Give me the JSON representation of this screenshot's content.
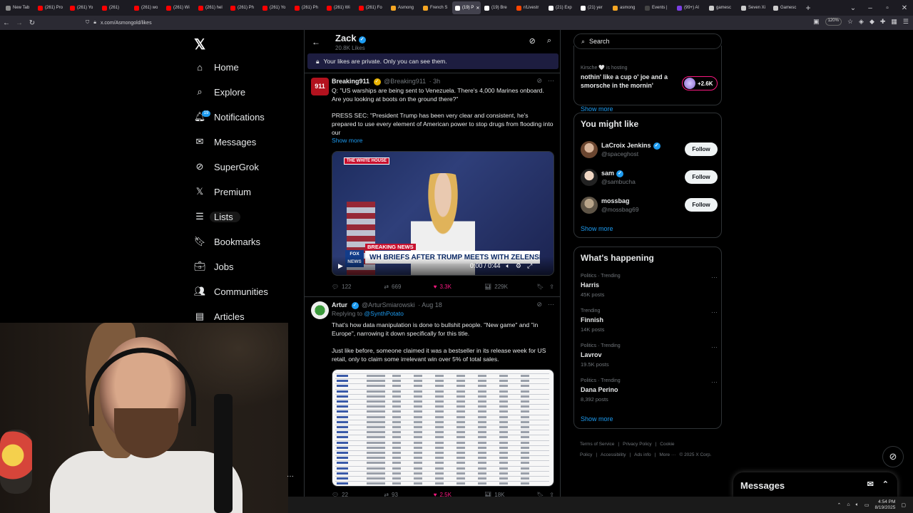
{
  "browser": {
    "tabs": [
      {
        "label": "New Tab",
        "color": "#8a8a8a"
      },
      {
        "label": "(261) Pro",
        "color": "#ff0000"
      },
      {
        "label": "(261) Yo",
        "color": "#ff0000"
      },
      {
        "label": "(261)",
        "color": "#ff0000"
      },
      {
        "label": "(261) wo",
        "color": "#ff0000"
      },
      {
        "label": "(261) Wi",
        "color": "#ff0000"
      },
      {
        "label": "(261) hel",
        "color": "#ff0000"
      },
      {
        "label": "(261) Ph",
        "color": "#ff0000"
      },
      {
        "label": "(261) Yo",
        "color": "#ff0000"
      },
      {
        "label": "(261) Ph",
        "color": "#ff0000"
      },
      {
        "label": "(261) Wi",
        "color": "#ff0000"
      },
      {
        "label": "(261) Fo",
        "color": "#ff0000"
      },
      {
        "label": "Asmong",
        "color": "#f5a623"
      },
      {
        "label": "French S",
        "color": "#f5a623"
      },
      {
        "label": "(19) P",
        "color": "#ffffff",
        "active": true
      },
      {
        "label": "(19) Bre",
        "color": "#ffffff"
      },
      {
        "label": "r/Livestr",
        "color": "#ff4500"
      },
      {
        "label": "(21) Exp",
        "color": "#ffffff"
      },
      {
        "label": "(21) yer",
        "color": "#ffffff"
      },
      {
        "label": "asmong",
        "color": "#f5a623"
      },
      {
        "label": "Events |",
        "color": "#444444"
      },
      {
        "label": "(99+) Al",
        "color": "#7b3fe4"
      },
      {
        "label": "gamesc",
        "color": "#cccccc"
      },
      {
        "label": "Seven Xi",
        "color": "#cccccc"
      },
      {
        "label": "Gamesc",
        "color": "#cccccc"
      }
    ],
    "url": "x.com/Asmongold/likes",
    "zoom": "120%"
  },
  "nav": {
    "items": [
      {
        "label": "Home",
        "icon": "home-icon"
      },
      {
        "label": "Explore",
        "icon": "search-icon"
      },
      {
        "label": "Notifications",
        "icon": "bell-icon"
      },
      {
        "label": "Messages",
        "icon": "mail-icon"
      },
      {
        "label": "SuperGrok",
        "icon": "grok-icon"
      },
      {
        "label": "Premium",
        "icon": "x-logo-icon"
      },
      {
        "label": "Lists",
        "icon": "list-icon"
      },
      {
        "label": "Bookmarks",
        "icon": "bookmark-icon"
      },
      {
        "label": "Jobs",
        "icon": "briefcase-icon"
      },
      {
        "label": "Communities",
        "icon": "people-icon"
      },
      {
        "label": "Articles",
        "icon": "article-icon"
      }
    ],
    "notif_count": "19"
  },
  "profile": {
    "name": "Zack",
    "likes": "20.8K Likes",
    "private_notice": "Your likes are private. Only you can see them."
  },
  "tweets": [
    {
      "name": "Breaking911",
      "handle": "@Breaking911",
      "time": "· 3h",
      "text1": "Q: \"US warships are being sent to Venezuela. There's 4,000 Marines onboard. Are you looking at boots on the ground there?\"",
      "text2": "PRESS SEC: \"President Trump has been very clear and consistent, he's prepared to use every element of American power to stop drugs from flooding into our",
      "show_more": "Show more",
      "video": {
        "badge": "THE WHITE HOUSE",
        "breaking": "BREAKING NEWS",
        "headline": "WH BRIEFS AFTER TRUMP MEETS WITH ZELENSKYY, PUTIN",
        "network": "FOX NEWS",
        "time": "0:00 / 0:44"
      },
      "replies": "122",
      "reposts": "669",
      "likes": "3.3K",
      "views": "229K"
    },
    {
      "name": "Artur",
      "handle": "@ArturSmiarowski",
      "time": "· Aug 18",
      "replying_label": "Replying to",
      "replying_to": "@SynthPotato",
      "text1": "That's how data manipulation is done to bullshit people. \"New game\" and \"in Europe\", narrowing it down specifically for this title.",
      "text2": "Just like before, someone claimed it was a bestseller in its release week for US retail, only to claim some irrelevant win over 5% of total sales.",
      "replies": "22",
      "reposts": "93",
      "likes": "2.5K",
      "views": "18K"
    }
  ],
  "right": {
    "search_placeholder": "Search",
    "space": {
      "host_line": "Kirsche 🤍 is hosting",
      "title": "nothin' like a cup o' joe and a smorsche in the mornin'",
      "listeners": "+2.6K",
      "show_more": "Show more"
    },
    "might_like": {
      "title": "You might like",
      "users": [
        {
          "name": "LaCroix Jenkins",
          "handle": "@spaceghost",
          "verified": true,
          "follow": "Follow"
        },
        {
          "name": "sam",
          "handle": "@sambucha",
          "verified": true,
          "follow": "Follow"
        },
        {
          "name": "mossbag",
          "handle": "@mossbag69",
          "verified": false,
          "follow": "Follow"
        }
      ],
      "show_more": "Show more"
    },
    "happening": {
      "title": "What's happening",
      "trends": [
        {
          "meta": "Politics · Trending",
          "name": "Harris",
          "posts": "45K posts"
        },
        {
          "meta": "Trending",
          "name": "Finnish",
          "posts": "14K posts"
        },
        {
          "meta": "Politics · Trending",
          "name": "Lavrov",
          "posts": "19.5K posts"
        },
        {
          "meta": "Politics · Trending",
          "name": "Dana Perino",
          "posts": "8,392 posts"
        }
      ],
      "show_more": "Show more"
    },
    "footer": [
      "Terms of Service",
      "|",
      "Privacy Policy",
      "|",
      "Cookie Policy",
      "|",
      "Accessibility",
      "|",
      "Ads info",
      "|",
      "More ···",
      "© 2025 X Corp."
    ],
    "messages_label": "Messages"
  },
  "taskbar": {
    "time": "4:54 PM",
    "date": "8/19/2025"
  }
}
